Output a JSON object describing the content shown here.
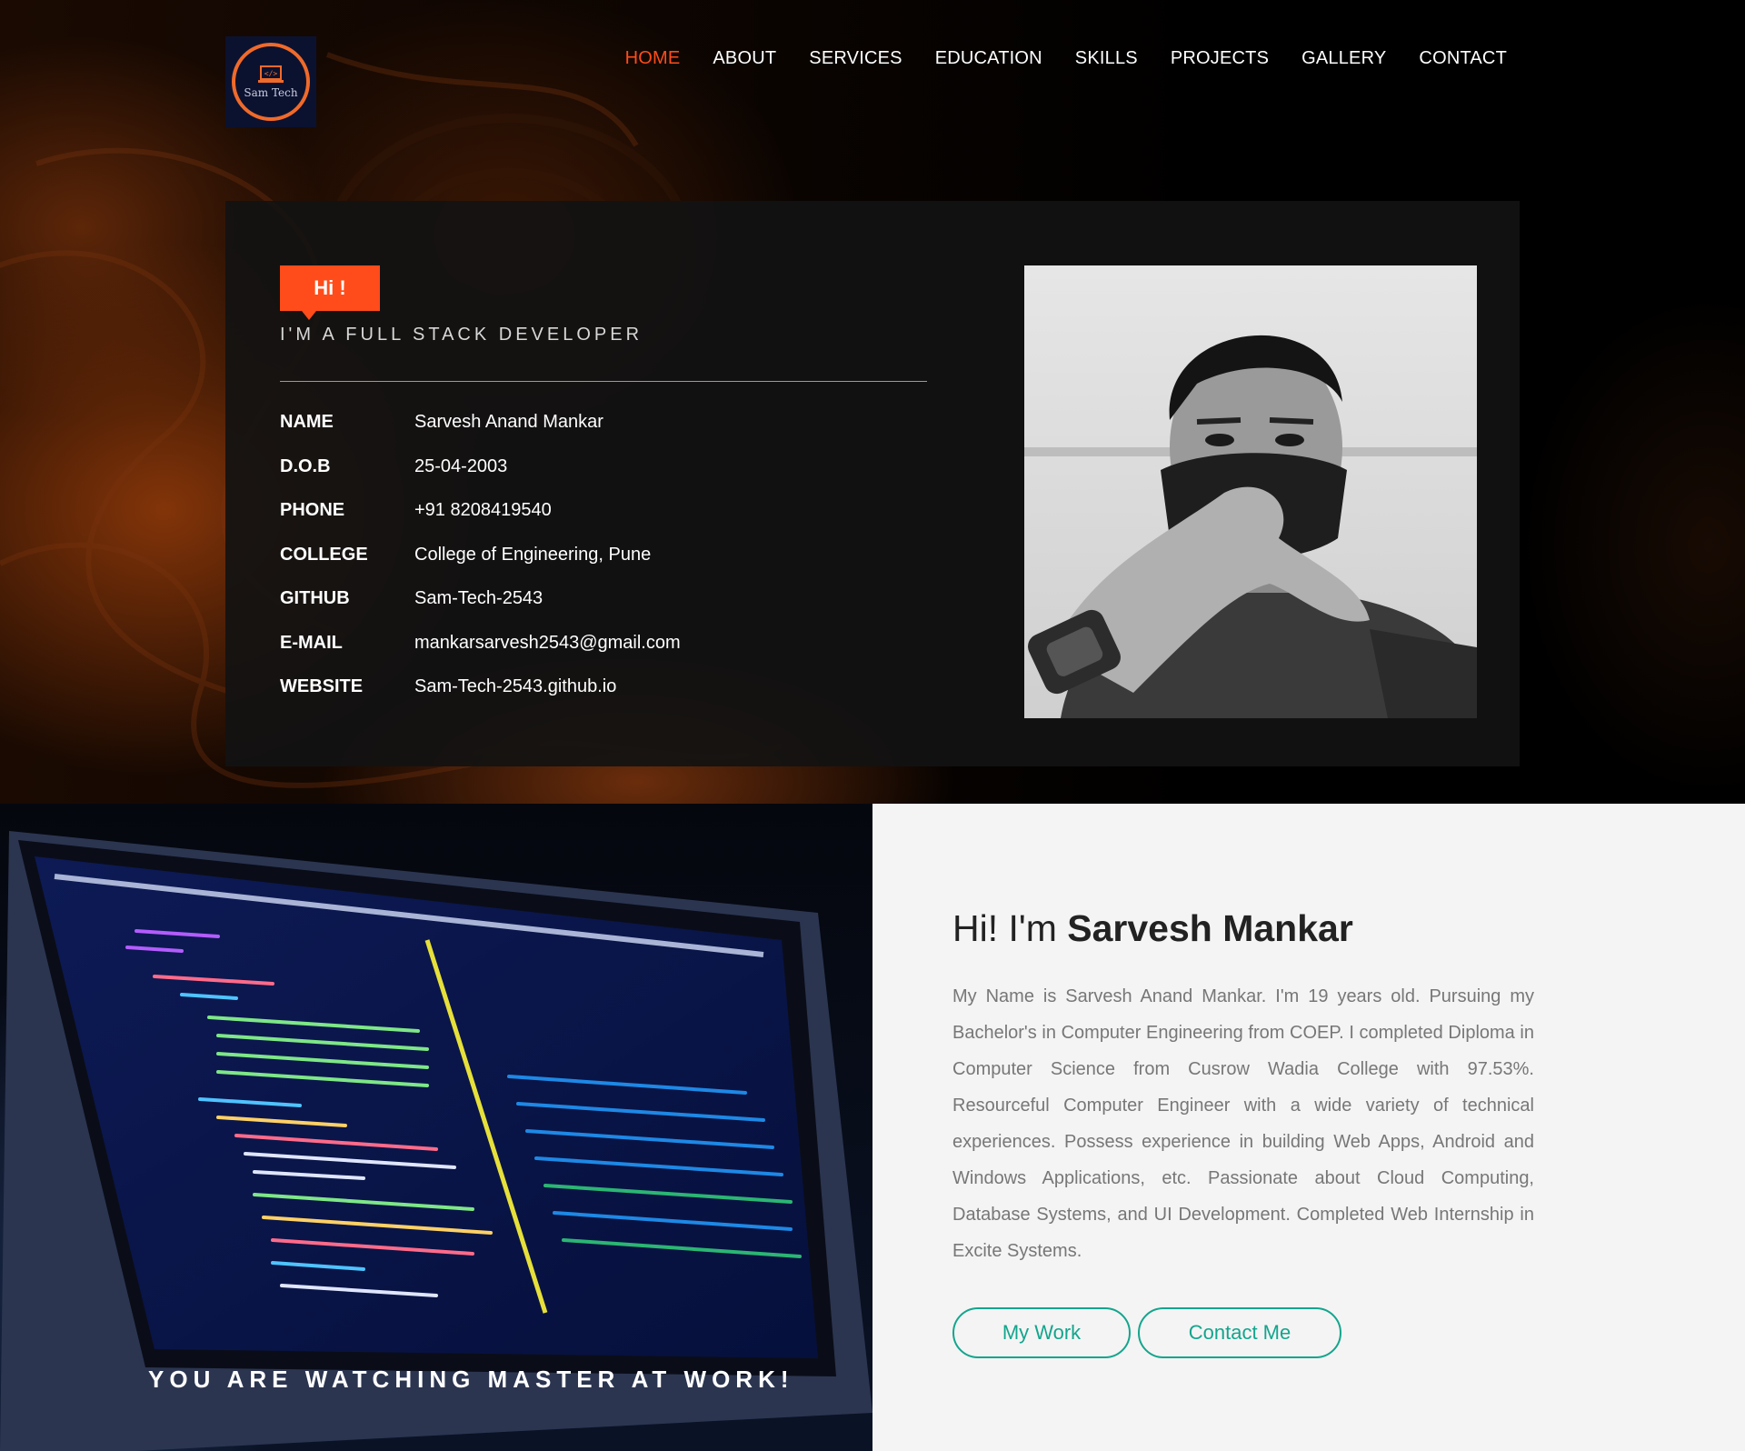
{
  "brand": {
    "logo_text": "Sam Tech",
    "logo_icon": "laptop-code-icon"
  },
  "nav": {
    "items": [
      {
        "label": "HOME",
        "active": true
      },
      {
        "label": "ABOUT"
      },
      {
        "label": "SERVICES"
      },
      {
        "label": "EDUCATION"
      },
      {
        "label": "SKILLS"
      },
      {
        "label": "PROJECTS"
      },
      {
        "label": "GALLERY"
      },
      {
        "label": "CONTACT"
      }
    ]
  },
  "hero": {
    "greeting": "Hi !",
    "role": "I'M A FULL STACK DEVELOPER",
    "info": [
      {
        "label": "NAME",
        "value": "Sarvesh Anand Mankar"
      },
      {
        "label": "D.O.B",
        "value": "25-04-2003"
      },
      {
        "label": "PHONE",
        "value": "+91 8208419540"
      },
      {
        "label": "COLLEGE",
        "value": "College of Engineering, Pune"
      },
      {
        "label": "GITHUB",
        "value": "Sam-Tech-2543"
      },
      {
        "label": "E-MAIL",
        "value": "mankarsarvesh2543@gmail.com"
      },
      {
        "label": "WEBSITE",
        "value": "Sam-Tech-2543.github.io"
      }
    ]
  },
  "showcase": {
    "tagline": "YOU ARE WATCHING MASTER AT WORK!"
  },
  "about": {
    "title_prefix": "Hi! I'm ",
    "title_name": "Sarvesh Mankar",
    "paragraph": "My Name is Sarvesh Anand Mankar. I'm 19 years old. Pursuing my Bachelor's in Computer Engineering from COEP. I completed Diploma in Computer Science from Cusrow Wadia College with 97.53%. Resourceful Computer Engineer with a wide variety of technical experiences. Possess experience in building Web Apps, Android and Windows Applications, etc. Passionate about Cloud Computing, Database Systems, and UI Development. Completed Web Internship in Excite Systems.",
    "buttons": {
      "work": "My Work",
      "contact": "Contact Me"
    }
  },
  "colors": {
    "accent": "#ff4c1a",
    "button": "#13a58d",
    "logo_ring": "#f06a2a"
  }
}
